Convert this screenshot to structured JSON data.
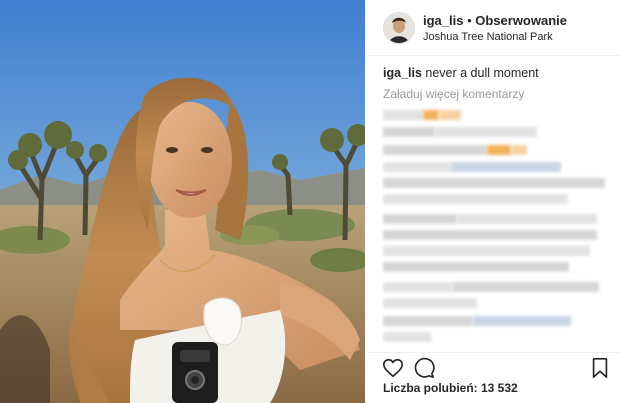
{
  "header": {
    "username": "iga_lis",
    "separator": " • ",
    "follow_label": "Obserwowanie",
    "location": "Joshua Tree National Park"
  },
  "caption": {
    "username": "iga_lis",
    "text": " never a dull moment"
  },
  "comments": {
    "load_more_label": "Załaduj więcej komentarzy"
  },
  "actions": {
    "icons": [
      "heart-icon",
      "comment-icon",
      "bookmark-icon"
    ]
  },
  "likes": {
    "label": "Liczba polubień: ",
    "count": "13 532"
  },
  "colors": {
    "text": "#262626",
    "muted": "#999999",
    "sky": "#4f86c8"
  }
}
